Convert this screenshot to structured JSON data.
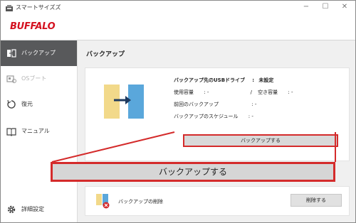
{
  "window": {
    "app_title": "スマートサイズズ",
    "controls": {
      "minimize": "−",
      "maximize": "☐",
      "close": "✕"
    }
  },
  "brand": {
    "logo": "BUFFALO",
    "color": "#d4111f"
  },
  "sidebar": {
    "items": [
      {
        "label": "バックアップ",
        "icon": "backup-icon",
        "active": true
      },
      {
        "label": "OSブート",
        "icon": "os-boot-icon",
        "disabled": true
      },
      {
        "label": "復元",
        "icon": "restore-icon"
      },
      {
        "label": "マニュアル",
        "icon": "manual-icon"
      }
    ],
    "settings": {
      "label": "詳細設定",
      "icon": "gear-icon"
    }
  },
  "main": {
    "title": "バックアップ",
    "info": {
      "dest_label": "バックアップ先のUSBドライブ",
      "dest_sep": ":",
      "dest_value": "未設定",
      "used_label": "使用容量",
      "used_value": ": -",
      "slash": "/",
      "free_label": "空き容量",
      "free_value": ": -",
      "last_label": "前回のバックアップ",
      "last_value": ": -",
      "schedule_label": "バックアップのスケジュール",
      "schedule_value": ": -"
    },
    "backup_button": "バックアップする",
    "delete_label": "バックアップの削除",
    "delete_button": "削除する"
  },
  "callout": {
    "label": "バックアップする",
    "highlight_color": "#d42b2b"
  }
}
